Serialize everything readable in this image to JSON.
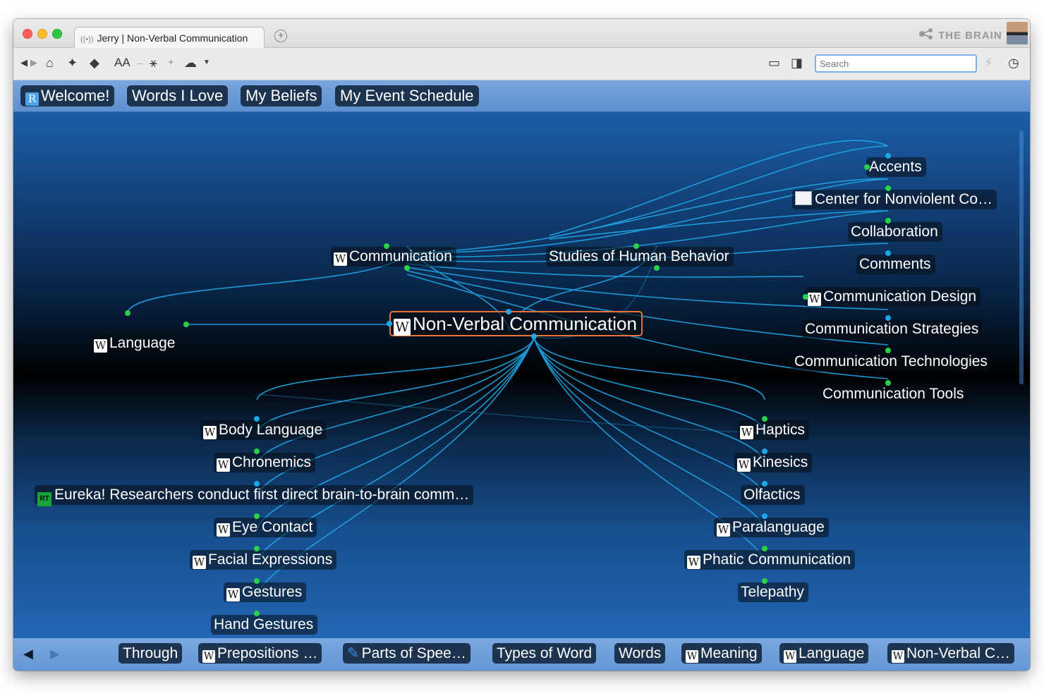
{
  "window": {
    "tab_title": "Jerry | Non-Verbal Communication",
    "brand_text": "THE BRAIN"
  },
  "toolbar": {
    "search_placeholder": "Search",
    "text_size_label": "AA"
  },
  "pins": [
    {
      "label": "Welcome!",
      "icon": "brain-logo-icon"
    },
    {
      "label": "Words I Love",
      "icon": ""
    },
    {
      "label": "My Beliefs",
      "icon": ""
    },
    {
      "label": "My Event Schedule",
      "icon": ""
    }
  ],
  "plex": {
    "active": {
      "label": "Non-Verbal Communication",
      "icon": "wikipedia-icon"
    },
    "parents": [
      {
        "label": "Communication",
        "icon": "wikipedia-icon"
      },
      {
        "label": "Studies of Human Behavior",
        "icon": ""
      }
    ],
    "jumps": [
      {
        "label": "Language",
        "icon": "wikipedia-icon"
      }
    ],
    "siblings": [
      {
        "label": "Accents",
        "icon": ""
      },
      {
        "label": "Center for Nonviolent Co…",
        "icon": "website-thumbnail-icon"
      },
      {
        "label": "Collaboration",
        "icon": ""
      },
      {
        "label": "Comments",
        "icon": ""
      },
      {
        "label": "Communication Design",
        "icon": "wikipedia-icon"
      },
      {
        "label": "Communication Strategies",
        "icon": ""
      },
      {
        "label": "Communication Technologies",
        "icon": ""
      },
      {
        "label": "Communication Tools",
        "icon": ""
      }
    ],
    "children_left": [
      {
        "label": "Body Language",
        "icon": "wikipedia-icon"
      },
      {
        "label": "Chronemics",
        "icon": "wikipedia-icon"
      },
      {
        "label": "Eureka! Researchers conduct first direct brain-to-brain comm…",
        "icon": "rt-news-icon"
      },
      {
        "label": "Eye Contact",
        "icon": "wikipedia-icon"
      },
      {
        "label": "Facial Expressions",
        "icon": "wikipedia-icon"
      },
      {
        "label": "Gestures",
        "icon": "wikipedia-icon"
      },
      {
        "label": "Hand Gestures",
        "icon": ""
      }
    ],
    "children_right": [
      {
        "label": "Haptics",
        "icon": "wikipedia-icon"
      },
      {
        "label": "Kinesics",
        "icon": "wikipedia-icon"
      },
      {
        "label": "Olfactics",
        "icon": ""
      },
      {
        "label": "Paralanguage",
        "icon": "wikipedia-icon"
      },
      {
        "label": "Phatic Communication",
        "icon": "wikipedia-icon"
      },
      {
        "label": "Telepathy",
        "icon": ""
      }
    ]
  },
  "history": [
    {
      "label": "Through",
      "icon": ""
    },
    {
      "label": "Prepositions …",
      "icon": "wikipedia-icon"
    },
    {
      "label": "Parts of Spee…",
      "icon": "parts-of-speech-icon"
    },
    {
      "label": "Types of Word",
      "icon": ""
    },
    {
      "label": "Words",
      "icon": ""
    },
    {
      "label": "Meaning",
      "icon": "wikipedia-icon"
    },
    {
      "label": "Language",
      "icon": "wikipedia-icon"
    },
    {
      "label": "Non-Verbal C…",
      "icon": "wikipedia-icon"
    }
  ],
  "colors": {
    "link": "#1ea7e6",
    "dot_green": "#29d24a",
    "active_border": "#e8743c",
    "pin_bg": "#1c3450"
  }
}
